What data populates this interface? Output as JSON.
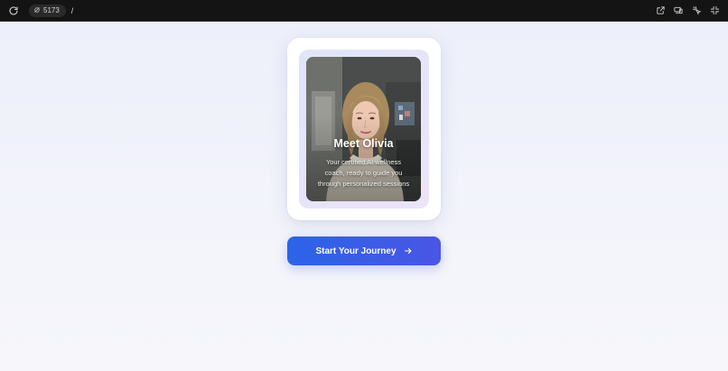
{
  "browser": {
    "port_label": "5173",
    "path": "/",
    "icons": [
      "reload-icon",
      "port-icon",
      "open-external-icon",
      "devices-icon",
      "inspect-icon",
      "shrink-icon"
    ]
  },
  "hero": {
    "title": "Meet Olivia",
    "subtitle": "Your certified AI wellness coach, ready to guide you through personalized sessions",
    "photo_alt": "Portrait of Olivia"
  },
  "cta": {
    "label": "Start Your Journey",
    "icon": "arrow-right-icon"
  },
  "colors": {
    "accent_start": "#2b64e8",
    "accent_end": "#4a55e6",
    "background": "#eceffa",
    "toolbar": "#141414"
  }
}
